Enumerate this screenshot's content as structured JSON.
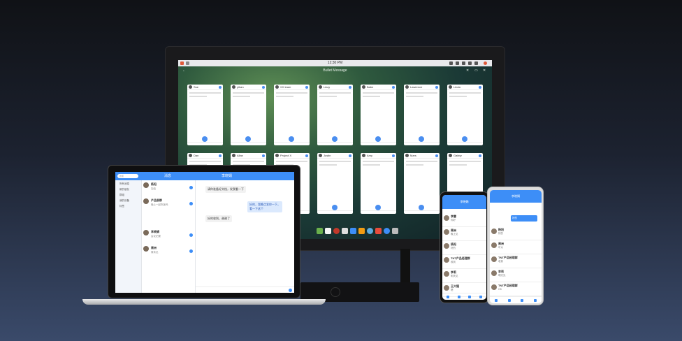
{
  "monitor": {
    "clock": "12:30 PM",
    "title": "Bullet Message",
    "windows": [
      {
        "name": "Sue"
      },
      {
        "name": "yihan"
      },
      {
        "name": "XX team"
      },
      {
        "name": "Lizzy"
      },
      {
        "name": "Babe"
      },
      {
        "name": "Lawrence"
      },
      {
        "name": "Linda"
      },
      {
        "name": "Dan"
      },
      {
        "name": "Allan"
      },
      {
        "name": "Project X"
      },
      {
        "name": "Justin"
      },
      {
        "name": "Amy"
      },
      {
        "name": "Mars"
      },
      {
        "name": "Gabby"
      }
    ],
    "accent": "#4a8ef0"
  },
  "laptop": {
    "search_placeholder": "搜索",
    "header_left": "消息",
    "header_right": "李晓娟",
    "side_items": [
      "所有消息",
      "新的朋友",
      "群组",
      "我的设备",
      "标签"
    ],
    "conversations": [
      {
        "name": "杨阳",
        "snippet": "加油"
      },
      {
        "name": "产品部群",
        "snippet": "晚上一起吃饭吗"
      },
      {
        "name": "李晓娟",
        "snippet": "会议纪要"
      },
      {
        "name": "周洲",
        "snippet": "周末见"
      }
    ],
    "chat": [
      {
        "text": "请你准备好文档，发我看一下",
        "me": false
      },
      {
        "text": "好的，我晚点发你一下，看一下这个",
        "me": true
      },
      {
        "text": "好的收到，谢谢了",
        "me": false
      }
    ]
  },
  "phone1": {
    "title": "李晓娟",
    "items": [
      {
        "name": "李雷",
        "snippet": "你好"
      },
      {
        "name": "周洲",
        "snippet": "晚上见"
      },
      {
        "name": "杨阳",
        "snippet": "好的"
      },
      {
        "name": "TNT产品经理群",
        "snippet": "收到"
      },
      {
        "name": "李莉",
        "snippet": "明天见"
      },
      {
        "name": "王大锤",
        "snippet": "嗯"
      }
    ]
  },
  "phone2": {
    "title": "李晓娟",
    "items": [
      {
        "name": "杨阳",
        "snippet": "好的"
      },
      {
        "name": "周洲",
        "snippet": "可以"
      },
      {
        "name": "TNT产品经理群",
        "snippet": "收到"
      },
      {
        "name": "李莉",
        "snippet": "明天见"
      },
      {
        "name": "TNT产品经理群",
        "snippet": "OK"
      }
    ]
  }
}
